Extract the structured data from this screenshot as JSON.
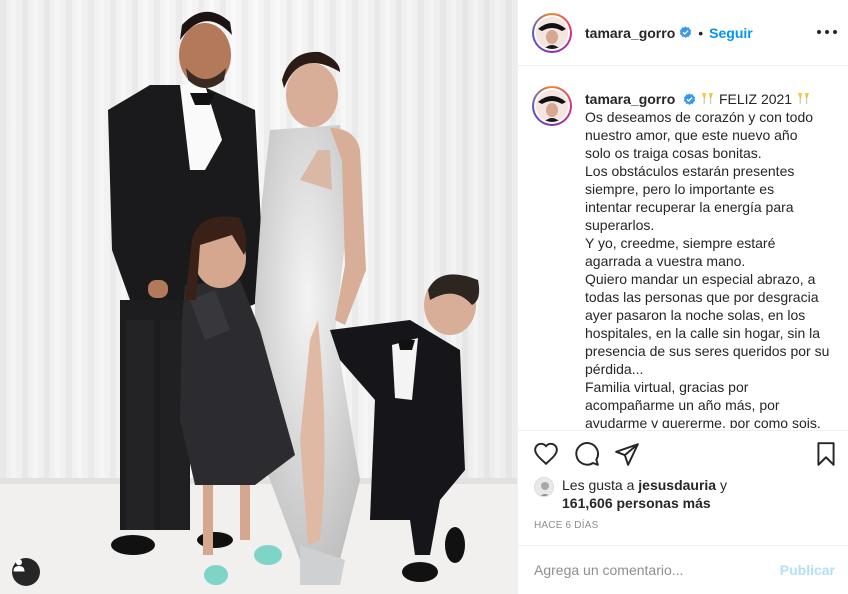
{
  "post": {
    "author": "tamara_gorro",
    "verified": true,
    "follow_label": "Seguir",
    "separator": "•",
    "more_icon": "more-options-icon"
  },
  "caption": {
    "username": "tamara_gorro",
    "lines": [
      "FELIZ 2021",
      "Os deseamos de corazón y con todo",
      "nuestro amor, que este nuevo año",
      "solo os traiga cosas bonitas.",
      "Los obstáculos estarán presentes",
      "siempre, pero lo importante es",
      "intentar recuperar la energía para",
      "superarlos.",
      "Y yo, creedme, siempre estaré",
      "agarrada a vuestra mano.",
      "Quiero mandar un especial abrazo, a",
      "todas las personas que por desgracia",
      "ayer pasaron la noche solas, en los",
      "hospitales, en la calle sin hogar, sin la",
      "presencia de sus seres queridos por su",
      "pérdida...",
      "Familia virtual, gracias por",
      "acompañarme un año más, por",
      "ayudarme y quererme, por como sois."
    ]
  },
  "likes": {
    "prefix": "Les gusta a",
    "user": "jesusdauria",
    "conjunction": "y",
    "count_text": "161,606 personas más"
  },
  "timestamp": "HACE 6 DÍAS",
  "comment": {
    "placeholder": "Agrega un comentario...",
    "post_label": "Publicar"
  },
  "colors": {
    "accent": "#0095f6",
    "accent_disabled": "#b2dffc",
    "verified": "#3897f0",
    "muted": "#8e8e8e"
  }
}
